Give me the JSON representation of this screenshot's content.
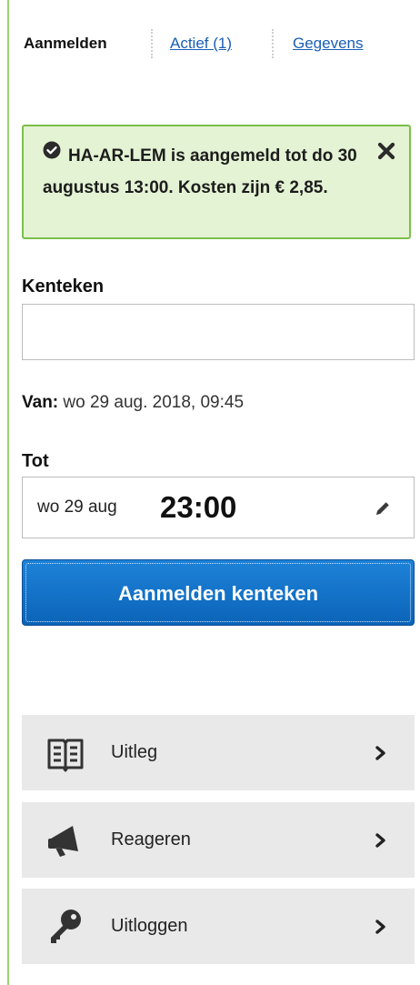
{
  "tabs": {
    "register": "Aanmelden",
    "active": "Actief (1)",
    "details": "Gegevens"
  },
  "alert": {
    "message": "HA-AR-LEM is aangemeld tot do 30 augustus 13:00. Kosten zijn € 2,85.",
    "color": "#e4f3d4",
    "border_color": "#7bbf4a"
  },
  "plate": {
    "label": "Kenteken",
    "value": "",
    "placeholder": ""
  },
  "from": {
    "label": "Van:",
    "value": "wo 29 aug. 2018, 09:45"
  },
  "until": {
    "label": "Tot",
    "date": "wo 29 aug",
    "time": "23:00"
  },
  "submit": {
    "label": "Aanmelden kenteken",
    "color": "#1d82d8"
  },
  "menu": {
    "items": [
      {
        "label": "Uitleg",
        "icon": "book-icon"
      },
      {
        "label": "Reageren",
        "icon": "megaphone-icon"
      },
      {
        "label": "Uitloggen",
        "icon": "key-icon"
      }
    ]
  }
}
